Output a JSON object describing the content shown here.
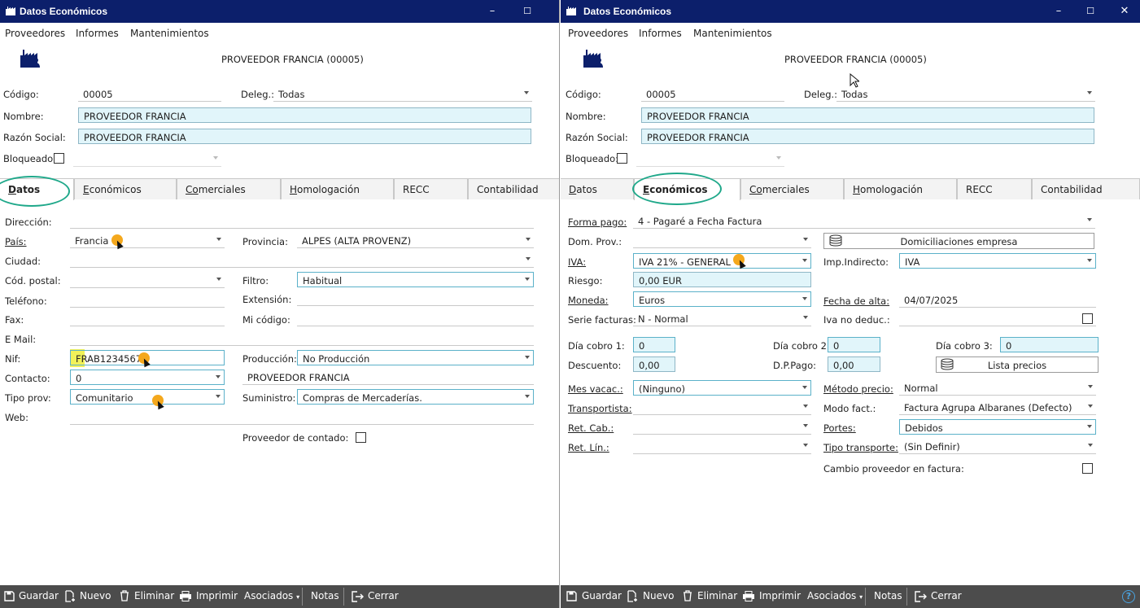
{
  "window": {
    "title": "Datos Económicos",
    "minimize": "–",
    "maximize": "☐",
    "close": "✕"
  },
  "menu": {
    "items": [
      "Proveedores",
      "Informes",
      "Mantenimientos"
    ]
  },
  "header": {
    "provider_title": "PROVEEDOR FRANCIA (00005)"
  },
  "form": {
    "codigo_label": "Código:",
    "codigo_value": "00005",
    "deleg_label": "Deleg.:",
    "deleg_value": "Todas",
    "nombre_label": "Nombre:",
    "nombre_value": "PROVEEDOR FRANCIA",
    "razon_label": "Razón Social:",
    "razon_value": "PROVEEDOR FRANCIA",
    "bloqueado_label": "Bloqueado:"
  },
  "tabs": [
    {
      "key": "D",
      "rest": "atos"
    },
    {
      "key": "E",
      "rest": "conómicos"
    },
    {
      "key": "Co",
      "rest": "merciales"
    },
    {
      "key": "H",
      "rest": "omologación"
    },
    {
      "key": "",
      "rest": "RECC"
    },
    {
      "key": "",
      "rest": "Contabilidad"
    }
  ],
  "datos": {
    "direccion_label": "Dirección:",
    "pais_label": "País:",
    "pais_value": "Francia",
    "provincia_label": "Provincia:",
    "provincia_value": "ALPES (ALTA PROVENZ)",
    "ciudad_label": "Ciudad:",
    "cp_label": "Cód. postal:",
    "filtro_label": "Filtro:",
    "filtro_value": "Habitual",
    "telefono_label": "Teléfono:",
    "extension_label": "Extensión:",
    "fax_label": "Fax:",
    "micodigo_label": "Mi código:",
    "email_label": "E Mail:",
    "nif_label": "Nif:",
    "nif_value": "FRAB12345678",
    "produccion_label": "Producción:",
    "produccion_value": "No Producción",
    "contacto_label": "Contacto:",
    "contacto_value": "0",
    "contacto_name": "PROVEEDOR FRANCIA",
    "tipoprov_label": "Tipo prov:",
    "tipoprov_value": "Comunitario",
    "suministro_label": "Suministro:",
    "suministro_value": "Compras de Mercaderías.",
    "web_label": "Web:",
    "contado_label": "Proveedor de contado:"
  },
  "economicos": {
    "formapago_label": "Forma pago:",
    "formapago_value": "4 - Pagaré a Fecha Factura",
    "domprov_label": "Dom. Prov.:",
    "domiciliaciones_button": "Domiciliaciones empresa",
    "iva_label": "IVA:",
    "iva_value": "IVA 21% - GENERAL",
    "impind_label": "Imp.Indirecto:",
    "impind_value": "IVA",
    "riesgo_label": "Riesgo:",
    "riesgo_value": "0,00 EUR",
    "moneda_label": "Moneda:",
    "moneda_value": "Euros",
    "fechaalta_label": "Fecha de alta:",
    "fechaalta_value": "04/07/2025",
    "serie_label": "Serie facturas:",
    "serie_value": "N - Normal",
    "ivanodeduc_label": "Iva no deduc.:",
    "dia1_label": "Día cobro 1:",
    "dia1_value": "0",
    "dia2_label": "Día cobro 2:",
    "dia2_value": "0",
    "dia3_label": "Día cobro 3:",
    "dia3_value": "0",
    "descuento_label": "Descuento:",
    "descuento_value": "0,00",
    "dppago_label": "D.P.Pago:",
    "dppago_value": "0,00",
    "listaprecios_button": "Lista precios",
    "mesvacac_label": "Mes vacac.:",
    "mesvacac_value": "(Ninguno)",
    "metodoprecio_label": "Método precio:",
    "metodoprecio_value": "Normal",
    "transportista_label": "Transportista:",
    "modofact_label": "Modo fact.:",
    "modofact_value": "Factura Agrupa Albaranes (Defecto)",
    "retcab_label": "Ret. Cab.:",
    "portes_label": "Portes:",
    "portes_value": "Debidos",
    "retlin_label": "Ret. Lín.:",
    "tipotransp_label": "Tipo transporte:",
    "tipotransp_value": "(Sin Definir)",
    "cambio_label": "Cambio proveedor en factura:"
  },
  "toolbar": {
    "guardar": "Guardar",
    "nuevo": "Nuevo",
    "eliminar": "Eliminar",
    "imprimir": "Imprimir",
    "asociados": "Asociados",
    "notas": "Notas",
    "cerrar": "Cerrar",
    "help": "?"
  },
  "colors": {
    "titlebar": "#0c1f6b",
    "toolbar": "#4c4c4c",
    "highlight_ellipse": "#1fa88a",
    "cursor_dot": "#f4a81d",
    "field_fill": "#e1f5fa"
  }
}
